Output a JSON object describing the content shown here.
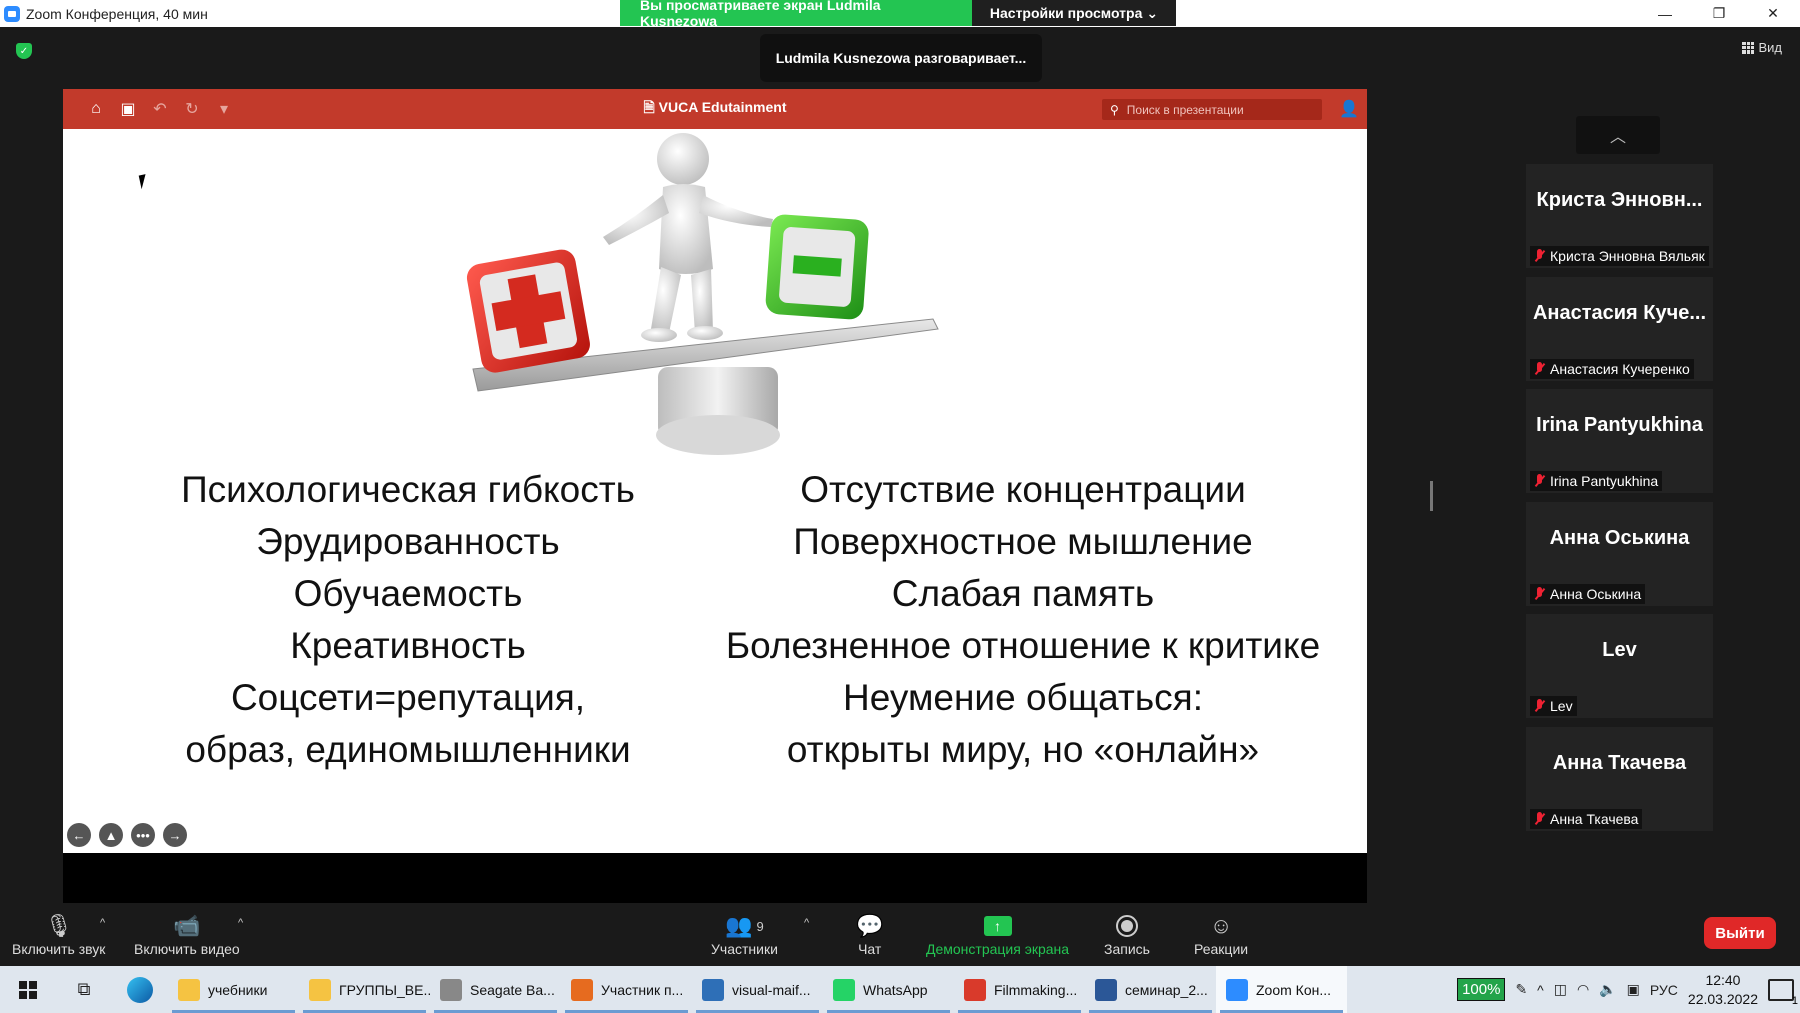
{
  "window": {
    "title": "Zoom Конференция, 40 мин",
    "viewing_banner": "Вы просматриваете экран Ludmila Kusnezowa",
    "view_settings": "Настройки просмотра",
    "talking": "Ludmila Kusnezowa разговаривает...",
    "view_label": "Вид"
  },
  "presentation": {
    "title": "VUCA Edutainment",
    "search_placeholder": "Поиск в презентации",
    "left_lines": [
      "Психологическая гибкость",
      "Эрудированность",
      "Обучаемость",
      "Креативность",
      "Соцсети=репутация,",
      "образ, единомышленники"
    ],
    "right_lines": [
      "Отсутствие концентрации",
      "Поверхностное мышление",
      "Слабая память",
      "Болезненное отношение к критике",
      "Неумение общаться:",
      "открыты миру, но «онлайн»"
    ]
  },
  "participants_panel": {
    "tiles": [
      {
        "display": "Криста Энновн...",
        "name": "Криста Энновна Вяльяк"
      },
      {
        "display": "Анастасия  Куче...",
        "name": "Анастасия Кучеренко"
      },
      {
        "display": "Irina Pantyukhina",
        "name": "Irina Pantyukhina"
      },
      {
        "display": "Анна Оськина",
        "name": "Анна Оськина"
      },
      {
        "display": "Lev",
        "name": "Lev"
      },
      {
        "display": "Анна Ткачева",
        "name": "Анна Ткачева"
      }
    ]
  },
  "toolbar": {
    "unmute": "Включить звук",
    "start_video": "Включить видео",
    "participants": "Участники",
    "participants_count": "9",
    "chat": "Чат",
    "share_screen": "Демонстрация экрана",
    "record": "Запись",
    "reactions": "Реакции",
    "leave": "Выйти"
  },
  "taskbar": {
    "apps": [
      {
        "label": "учебники",
        "icon": "folder-icon",
        "color": "#f5c342"
      },
      {
        "label": "ГРУППЫ_ВЕ...",
        "icon": "folder-icon",
        "color": "#f5c342"
      },
      {
        "label": "Seagate Ba...",
        "icon": "drive-icon",
        "color": "#888888"
      },
      {
        "label": "Участник п...",
        "icon": "firefox-icon",
        "color": "#e66b1f"
      },
      {
        "label": "visual-maif...",
        "icon": "image-icon",
        "color": "#2e6fb7"
      },
      {
        "label": "WhatsApp",
        "icon": "whatsapp-icon",
        "color": "#25d366"
      },
      {
        "label": "Filmmaking...",
        "icon": "pdf-icon",
        "color": "#d93a2b"
      },
      {
        "label": "семинар_2...",
        "icon": "word-icon",
        "color": "#2b5797"
      },
      {
        "label": "Zoom Кон...",
        "icon": "zoom-icon",
        "color": "#2d8cff"
      }
    ],
    "battery": "100%",
    "language": "РУС",
    "time": "12:40",
    "date": "22.03.2022",
    "notification_count": "1"
  }
}
